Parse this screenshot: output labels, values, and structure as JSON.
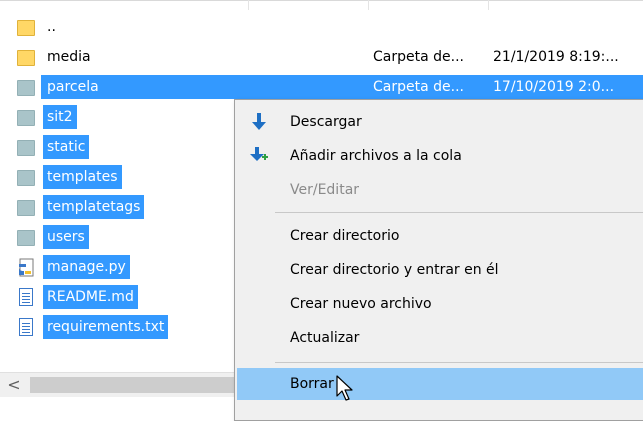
{
  "files": [
    {
      "name": "..",
      "type": "",
      "date": "",
      "icon": "folder-icon-yellow",
      "selected": false
    },
    {
      "name": "media",
      "type": "Carpeta de...",
      "date": "21/1/2019 8:19:...",
      "icon": "folder-icon-yellow",
      "selected": false
    },
    {
      "name": "parcela",
      "type": "Carpeta de...",
      "date": "17/10/2019 2:0...",
      "icon": "folder-icon-gray",
      "selected": true
    },
    {
      "name": "sit2",
      "type": "",
      "date": "",
      "icon": "folder-icon-gray",
      "selected": true
    },
    {
      "name": "static",
      "type": "",
      "date": "",
      "icon": "folder-icon-gray",
      "selected": true
    },
    {
      "name": "templates",
      "type": "",
      "date": "",
      "icon": "folder-icon-gray",
      "selected": true
    },
    {
      "name": "templatetags",
      "type": "",
      "date": "",
      "icon": "folder-icon-gray",
      "selected": true
    },
    {
      "name": "users",
      "type": "",
      "date": "",
      "icon": "folder-icon-gray",
      "selected": true
    },
    {
      "name": "manage.py",
      "type": "",
      "date": "",
      "icon": "python-file-icon",
      "selected": true
    },
    {
      "name": "README.md",
      "type": "",
      "date": "",
      "icon": "text-file-icon",
      "selected": true
    },
    {
      "name": "requirements.txt",
      "type": "",
      "date": "",
      "icon": "text-file-icon",
      "selected": true
    }
  ],
  "context_menu": {
    "items": [
      {
        "label": "Descargar",
        "icon": "download-arrow-icon",
        "disabled": false
      },
      {
        "label": "Añadir archivos a la cola",
        "icon": "add-to-queue-icon",
        "disabled": false
      },
      {
        "label": "Ver/Editar",
        "icon": "",
        "disabled": true
      },
      {
        "label": "Crear directorio",
        "icon": "",
        "disabled": false
      },
      {
        "label": "Crear directorio y entrar en él",
        "icon": "",
        "disabled": false
      },
      {
        "label": "Crear nuevo archivo",
        "icon": "",
        "disabled": false
      },
      {
        "label": "Actualizar",
        "icon": "",
        "disabled": false
      },
      {
        "label": "Borrar",
        "icon": "",
        "disabled": false,
        "highlighted": true
      }
    ]
  },
  "scrollbar": {
    "left_arrow": "<"
  },
  "colors": {
    "selection": "#3399ff",
    "menu_highlight": "#91c9f7",
    "menu_bg": "#f0f0f0",
    "folder_yellow": "#ffd766"
  }
}
